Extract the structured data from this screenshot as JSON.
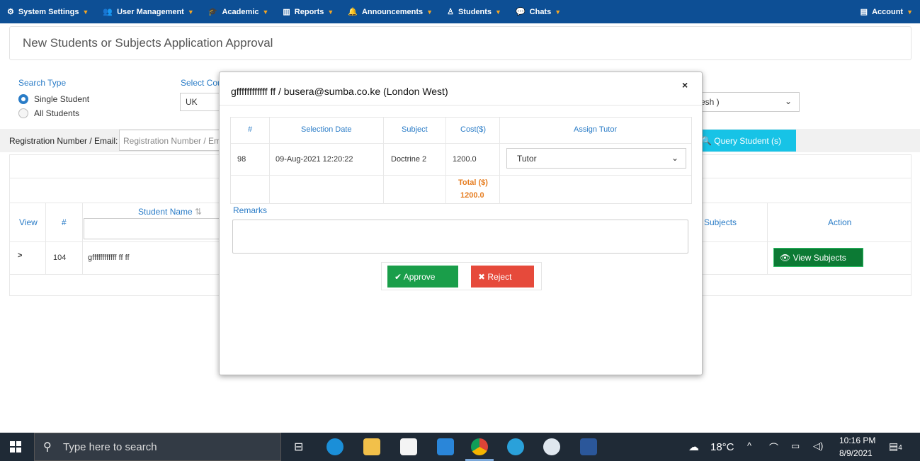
{
  "nav": {
    "items": [
      {
        "label": "System Settings",
        "icon": "cogs-icon"
      },
      {
        "label": "User Management",
        "icon": "users-icon"
      },
      {
        "label": "Academic",
        "icon": "graduation-cap-icon"
      },
      {
        "label": "Reports",
        "icon": "bar-chart-icon"
      },
      {
        "label": "Announcements",
        "icon": "bell-icon"
      },
      {
        "label": "Students",
        "icon": "student-icon"
      },
      {
        "label": "Chats",
        "icon": "chat-icon"
      }
    ],
    "account": "Account"
  },
  "page": {
    "title": "New Students or Subjects Application Approval"
  },
  "search": {
    "type_label": "Search Type",
    "options": [
      "Single Student",
      "All Students"
    ],
    "selected": "Single Student",
    "country_label": "Select Cou",
    "country_value": "UK",
    "right_select_value": "esh )",
    "reg_label": "Registration Number / Email:",
    "reg_placeholder": "Registration Number / Emai",
    "query_button": "Query Student (s)"
  },
  "table": {
    "headers": {
      "view": "View",
      "num": "#",
      "student_name": "Student Name",
      "subjects": "l Subjects",
      "action": "Action"
    },
    "rows": [
      {
        "expand": ">",
        "num": "104",
        "name": "gffffffffffff ff ff",
        "action": "View Subjects"
      }
    ]
  },
  "modal": {
    "title": "gffffffffffff ff / busera@sumba.co.ke (London West)",
    "close": "×",
    "headers": {
      "num": "#",
      "date": "Selection Date",
      "subject": "Subject",
      "cost": "Cost($)",
      "tutor": "Assign Tutor"
    },
    "rows": [
      {
        "num": "98",
        "date": "09-Aug-2021 12:20:22",
        "subject": "Doctrine 2",
        "cost": "1200.0",
        "tutor": "Tutor"
      }
    ],
    "total_label": "Total ($)",
    "total_value": "1200.0",
    "remarks_label": "Remarks",
    "approve": "Approve",
    "reject": "Reject"
  },
  "taskbar": {
    "search_placeholder": "Type here to search",
    "temperature": "18°C",
    "time": "10:16 PM",
    "date": "8/9/2021",
    "notifications": "4"
  },
  "colors": {
    "nav_bg": "#0d4f95",
    "accent_blue": "#2a7cc7",
    "approve": "#1a9e4a",
    "reject": "#e64a3b",
    "query": "#17c3e6",
    "total": "#e67e22"
  }
}
